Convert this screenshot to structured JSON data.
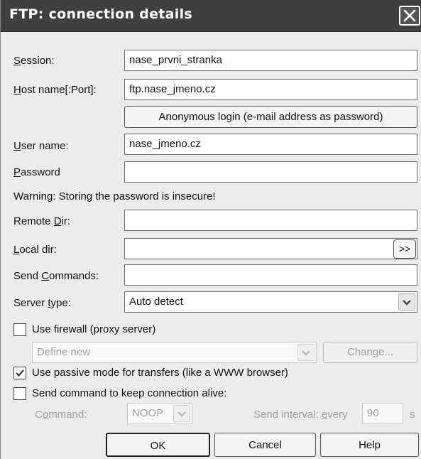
{
  "window": {
    "title": "FTP: connection details",
    "close_icon": "close-icon"
  },
  "form": {
    "session_label_u": "S",
    "session_label_rest": "ession:",
    "session_value": "nase_prvni_stranka",
    "host_label_u": "H",
    "host_label_rest": "ost name[:Port]:",
    "host_value": "ftp.nase_jmeno.cz",
    "anonymous_button": "Anonymous login (e-mail address as password)",
    "user_label_u": "U",
    "user_label_rest": "ser name:",
    "user_value": "nase_jmeno.cz",
    "password_label_u": "P",
    "password_label_rest": "assword",
    "password_value": "",
    "warning": "Warning: Storing the password is insecure!",
    "remote_label_pre": "Remote ",
    "remote_label_u": "D",
    "remote_label_rest": "ir:",
    "remote_value": "",
    "local_label_u": "L",
    "local_label_rest": "ocal dir:",
    "local_value": "",
    "browse_button": ">>",
    "sendcmd_label_pre": "Send ",
    "sendcmd_label_u": "C",
    "sendcmd_label_rest": "ommands:",
    "sendcmd_value": "",
    "server_label_pre": "Server ",
    "server_label_u": "t",
    "server_label_rest": "ype:",
    "server_value": "Auto detect",
    "firewall": {
      "label": "Use firewall (proxy server)",
      "checked": false
    },
    "firewall_select": "Define new",
    "change_button": "Change...",
    "passive": {
      "label": "Use passive mode for transfers (like a WWW browser)",
      "checked": true
    },
    "keepalive": {
      "label": "Send command to keep connection alive:",
      "checked": false
    },
    "command_label_pre": "C",
    "command_label_u": "o",
    "command_label_rest": "mmand:",
    "command_value": "NOOP",
    "interval_label_pre": "Send interval: ",
    "interval_label_u": "e",
    "interval_label_rest": "very",
    "interval_value": "90",
    "interval_unit": "s"
  },
  "buttons": {
    "ok": "OK",
    "cancel": "Cancel",
    "help": "Help"
  }
}
